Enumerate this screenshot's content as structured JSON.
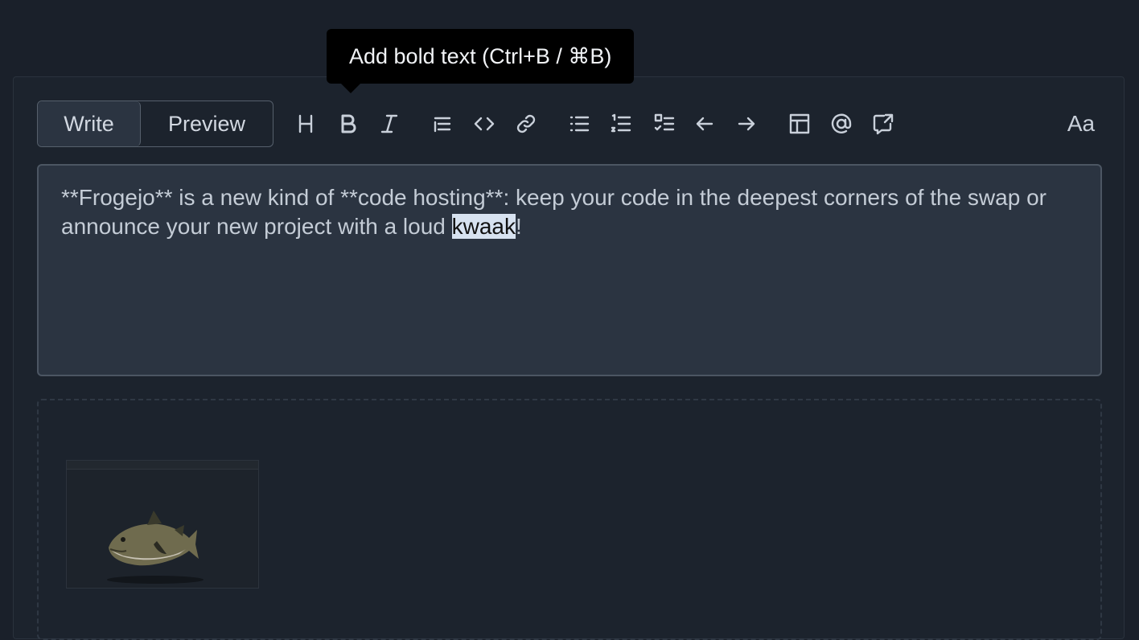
{
  "tabs": {
    "write": "Write",
    "preview": "Preview"
  },
  "toolbar": {
    "tooltip": "Add bold text (Ctrl+B / ⌘B)",
    "font_toggle": "Aa",
    "icons": [
      "heading-icon",
      "bold-icon",
      "italic-icon",
      "quote-icon",
      "code-icon",
      "link-icon",
      "unordered-list-icon",
      "ordered-list-icon",
      "task-list-icon",
      "unindent-icon",
      "indent-icon",
      "table-icon",
      "mention-icon",
      "reference-icon"
    ]
  },
  "editor": {
    "text_before": "**Frogejo** is a new kind of **code hosting**: keep your code in the deepest corners of the swap or announce your new project with a loud ",
    "selected_text": "kwaak",
    "text_after": "!"
  },
  "colors": {
    "background": "#1a202a",
    "editor_bg": "#2b3441",
    "tooltip_bg": "#000000",
    "selection": "#d7e2f0"
  }
}
